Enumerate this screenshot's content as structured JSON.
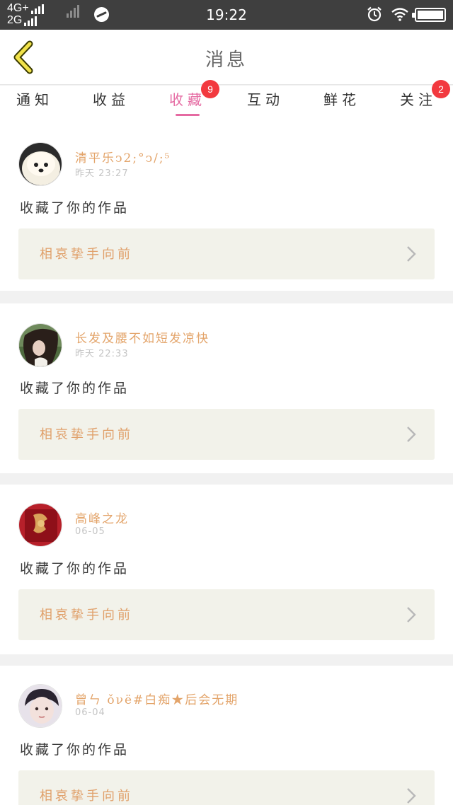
{
  "status_bar": {
    "network_top": "4G+",
    "network_bottom": "2G",
    "time": "19:22"
  },
  "header": {
    "title": "消息"
  },
  "tabs": [
    {
      "label": "通知",
      "badge": ""
    },
    {
      "label": "收益",
      "badge": ""
    },
    {
      "label": "收藏",
      "badge": "9",
      "active": true
    },
    {
      "label": "互动",
      "badge": ""
    },
    {
      "label": "鲜花",
      "badge": ""
    },
    {
      "label": "关注",
      "badge": "2"
    }
  ],
  "messages": [
    {
      "username": "清平乐ↄ2;°ↄ/;⁵",
      "time": "昨天 23:27",
      "action": "收藏了你的作品",
      "work_title": "相哀挚手向前",
      "avatar": "dog-avatar"
    },
    {
      "username": "长发及腰不如短发凉快",
      "time": "昨天 22:33",
      "action": "收藏了你的作品",
      "work_title": "相哀挚手向前",
      "avatar": "girl-avatar"
    },
    {
      "username": "高峰之龙",
      "time": "06-05",
      "action": "收藏了你的作品",
      "work_title": "相哀挚手向前",
      "avatar": "red-art-avatar"
    },
    {
      "username": "曾ㄣ ǒνё#白痴★后会无期",
      "time": "06-04",
      "action": "收藏了你的作品",
      "work_title": "相哀挚手向前",
      "avatar": "boy-avatar"
    }
  ],
  "colors": {
    "accent": "#e56aa2",
    "badge": "#f2393f",
    "username": "#e3a46a",
    "work_card_bg": "#f2f2ea"
  }
}
